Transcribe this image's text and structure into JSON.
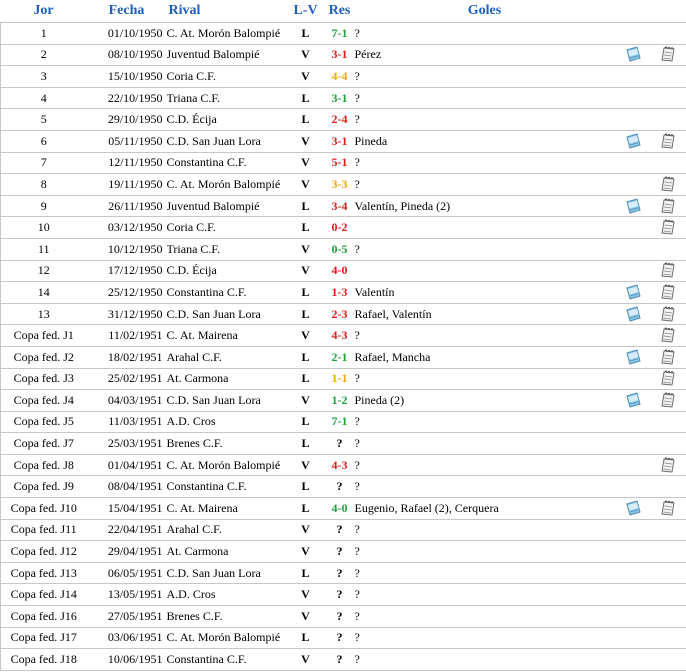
{
  "headers": {
    "jor": "Jor",
    "fecha": "Fecha",
    "rival": "Rival",
    "lv": "L-V",
    "res": "Res",
    "goles": "Goles"
  },
  "colors": {
    "header": "#1f5fbf",
    "win": "#1aa23a",
    "loss": "#e41b1b",
    "draw": "#f0a800"
  },
  "icons": {
    "chronicle": "newspaper-icon",
    "lineup": "notepad-icon"
  },
  "rows": [
    {
      "jor": "1",
      "fecha": "01/10/1950",
      "rival": "C. At. Morón Balompié",
      "lv": "L",
      "res": "7-1",
      "outcome": "win",
      "goles": "?",
      "ic1": false,
      "ic2": false
    },
    {
      "jor": "2",
      "fecha": "08/10/1950",
      "rival": "Juventud Balompié",
      "lv": "V",
      "res": "3-1",
      "outcome": "loss",
      "goles": "Pérez",
      "ic1": true,
      "ic2": true
    },
    {
      "jor": "3",
      "fecha": "15/10/1950",
      "rival": "Coria C.F.",
      "lv": "V",
      "res": "4-4",
      "outcome": "draw",
      "goles": "?",
      "ic1": false,
      "ic2": false
    },
    {
      "jor": "4",
      "fecha": "22/10/1950",
      "rival": "Triana C.F.",
      "lv": "L",
      "res": "3-1",
      "outcome": "win",
      "goles": "?",
      "ic1": false,
      "ic2": false
    },
    {
      "jor": "5",
      "fecha": "29/10/1950",
      "rival": "C.D. Écija",
      "lv": "L",
      "res": "2-4",
      "outcome": "loss",
      "goles": "?",
      "ic1": false,
      "ic2": false
    },
    {
      "jor": "6",
      "fecha": "05/11/1950",
      "rival": "C.D. San Juan Lora",
      "lv": "V",
      "res": "3-1",
      "outcome": "loss",
      "goles": "Pineda",
      "ic1": true,
      "ic2": true
    },
    {
      "jor": "7",
      "fecha": "12/11/1950",
      "rival": "Constantina C.F.",
      "lv": "V",
      "res": "5-1",
      "outcome": "loss",
      "goles": "?",
      "ic1": false,
      "ic2": false
    },
    {
      "jor": "8",
      "fecha": "19/11/1950",
      "rival": "C. At. Morón Balompié",
      "lv": "V",
      "res": "3-3",
      "outcome": "draw",
      "goles": "?",
      "ic1": false,
      "ic2": true
    },
    {
      "jor": "9",
      "fecha": "26/11/1950",
      "rival": "Juventud Balompié",
      "lv": "L",
      "res": "3-4",
      "outcome": "loss",
      "goles": "Valentín, Pineda (2)",
      "ic1": true,
      "ic2": true
    },
    {
      "jor": "10",
      "fecha": "03/12/1950",
      "rival": "Coria C.F.",
      "lv": "L",
      "res": "0-2",
      "outcome": "loss",
      "goles": "",
      "ic1": false,
      "ic2": true
    },
    {
      "jor": "11",
      "fecha": "10/12/1950",
      "rival": "Triana C.F.",
      "lv": "V",
      "res": "0-5",
      "outcome": "win",
      "goles": "?",
      "ic1": false,
      "ic2": false
    },
    {
      "jor": "12",
      "fecha": "17/12/1950",
      "rival": "C.D. Écija",
      "lv": "V",
      "res": "4-0",
      "outcome": "loss",
      "goles": "",
      "ic1": false,
      "ic2": true
    },
    {
      "jor": "14",
      "fecha": "25/12/1950",
      "rival": "Constantina C.F.",
      "lv": "L",
      "res": "1-3",
      "outcome": "loss",
      "goles": "Valentín",
      "ic1": true,
      "ic2": true
    },
    {
      "jor": "13",
      "fecha": "31/12/1950",
      "rival": "C.D. San Juan Lora",
      "lv": "L",
      "res": "2-3",
      "outcome": "loss",
      "goles": "Rafael, Valentín",
      "ic1": true,
      "ic2": true
    },
    {
      "jor": "Copa fed. J1",
      "fecha": "11/02/1951",
      "rival": "C. At. Mairena",
      "lv": "V",
      "res": "4-3",
      "outcome": "loss",
      "goles": "?",
      "ic1": false,
      "ic2": true
    },
    {
      "jor": "Copa fed. J2",
      "fecha": "18/02/1951",
      "rival": "Arahal C.F.",
      "lv": "L",
      "res": "2-1",
      "outcome": "win",
      "goles": "Rafael, Mancha",
      "ic1": true,
      "ic2": true
    },
    {
      "jor": "Copa fed. J3",
      "fecha": "25/02/1951",
      "rival": "At. Carmona",
      "lv": "L",
      "res": "1-1",
      "outcome": "draw",
      "goles": "?",
      "ic1": false,
      "ic2": true
    },
    {
      "jor": "Copa fed. J4",
      "fecha": "04/03/1951",
      "rival": "C.D. San Juan Lora",
      "lv": "V",
      "res": "1-2",
      "outcome": "win",
      "goles": "Pineda (2)",
      "ic1": true,
      "ic2": true
    },
    {
      "jor": "Copa fed. J5",
      "fecha": "11/03/1951",
      "rival": "A.D. Cros",
      "lv": "L",
      "res": "7-1",
      "outcome": "win",
      "goles": "?",
      "ic1": false,
      "ic2": false
    },
    {
      "jor": "Copa fed. J7",
      "fecha": "25/03/1951",
      "rival": "Brenes C.F.",
      "lv": "L",
      "res": "?",
      "outcome": "unk",
      "goles": "?",
      "ic1": false,
      "ic2": false
    },
    {
      "jor": "Copa fed. J8",
      "fecha": "01/04/1951",
      "rival": "C. At. Morón Balompié",
      "lv": "V",
      "res": "4-3",
      "outcome": "loss",
      "goles": "?",
      "ic1": false,
      "ic2": true
    },
    {
      "jor": "Copa fed. J9",
      "fecha": "08/04/1951",
      "rival": "Constantina C.F.",
      "lv": "L",
      "res": "?",
      "outcome": "unk",
      "goles": "?",
      "ic1": false,
      "ic2": false
    },
    {
      "jor": "Copa fed. J10",
      "fecha": "15/04/1951",
      "rival": "C. At. Mairena",
      "lv": "L",
      "res": "4-0",
      "outcome": "win",
      "goles": "Eugenio, Rafael (2), Cerquera",
      "ic1": true,
      "ic2": true
    },
    {
      "jor": "Copa fed. J11",
      "fecha": "22/04/1951",
      "rival": "Arahal C.F.",
      "lv": "V",
      "res": "?",
      "outcome": "unk",
      "goles": "?",
      "ic1": false,
      "ic2": false
    },
    {
      "jor": "Copa fed. J12",
      "fecha": "29/04/1951",
      "rival": "At. Carmona",
      "lv": "V",
      "res": "?",
      "outcome": "unk",
      "goles": "?",
      "ic1": false,
      "ic2": false
    },
    {
      "jor": "Copa fed. J13",
      "fecha": "06/05/1951",
      "rival": "C.D. San Juan Lora",
      "lv": "L",
      "res": "?",
      "outcome": "unk",
      "goles": "?",
      "ic1": false,
      "ic2": false
    },
    {
      "jor": "Copa fed. J14",
      "fecha": "13/05/1951",
      "rival": "A.D. Cros",
      "lv": "V",
      "res": "?",
      "outcome": "unk",
      "goles": "?",
      "ic1": false,
      "ic2": false
    },
    {
      "jor": "Copa fed. J16",
      "fecha": "27/05/1951",
      "rival": "Brenes C.F.",
      "lv": "V",
      "res": "?",
      "outcome": "unk",
      "goles": "?",
      "ic1": false,
      "ic2": false
    },
    {
      "jor": "Copa fed. J17",
      "fecha": "03/06/1951",
      "rival": "C. At. Morón Balompié",
      "lv": "L",
      "res": "?",
      "outcome": "unk",
      "goles": "?",
      "ic1": false,
      "ic2": false
    },
    {
      "jor": "Copa fed. J18",
      "fecha": "10/06/1951",
      "rival": "Constantina C.F.",
      "lv": "V",
      "res": "?",
      "outcome": "unk",
      "goles": "?",
      "ic1": false,
      "ic2": false
    }
  ]
}
